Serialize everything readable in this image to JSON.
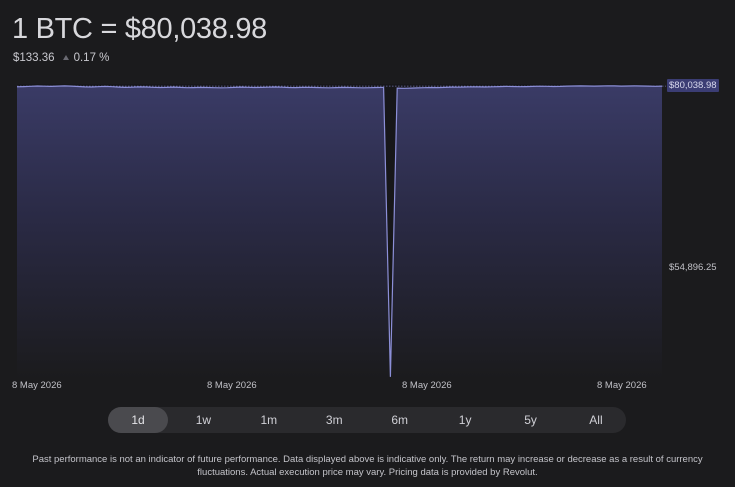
{
  "header": {
    "price_title": "1 BTC = $80,038.98",
    "change_amount": "$133.36",
    "change_percent": "0.17 %"
  },
  "colors": {
    "background": "#1b1b1d",
    "line": "#8c8fd8",
    "fill_top": "#3a3b66",
    "badge": "#3b3d74"
  },
  "range_selector": {
    "selected": "1d",
    "options": [
      "1d",
      "1w",
      "1m",
      "3m",
      "6m",
      "1y",
      "5y",
      "All"
    ]
  },
  "chart_data": {
    "type": "area",
    "y_labels": {
      "current": "$80,038.98",
      "mid": "$54,896.25"
    },
    "x_tick_labels": [
      "8 May 2026",
      "8 May 2026",
      "8 May 2026",
      "8 May 2026"
    ],
    "ylim": [
      29700,
      80400
    ],
    "reference_line": 80038.98,
    "series": [
      {
        "values": [
          79920,
          79960,
          80010,
          80050,
          80020,
          79990,
          80030,
          80080,
          80040,
          79970,
          79900,
          79880,
          79940,
          79990,
          79930,
          79870,
          79820,
          79850,
          79900,
          79880,
          79830,
          79790,
          79820,
          79860,
          79810,
          79760,
          79780,
          79820,
          79800,
          79760,
          79740,
          79770,
          79820,
          79860,
          79830,
          79790,
          79810,
          79850,
          79880,
          79840,
          79800,
          79780,
          79810,
          79830,
          79800,
          79770,
          79750,
          79780,
          79810,
          79790,
          79760,
          79740,
          79770,
          79790,
          79810,
          29900,
          79700,
          79660,
          79690,
          79720,
          79760,
          79800,
          79780,
          79820,
          79860,
          79840,
          79880,
          79920,
          79900,
          79880,
          79910,
          79950,
          79990,
          79970,
          79940,
          79960,
          79990,
          80020,
          80000,
          79970,
          79990,
          80030,
          80060,
          80080,
          80050,
          80030,
          80060,
          80090,
          80070,
          80040,
          80060,
          80080,
          80050,
          80030,
          80010,
          80039
        ]
      }
    ]
  },
  "disclaimer": "Past performance is not an indicator of future performance. Data displayed above is indicative only. The return may increase or decrease as a result of currency fluctuations. Actual execution price may vary. Pricing data is provided by Revolut."
}
